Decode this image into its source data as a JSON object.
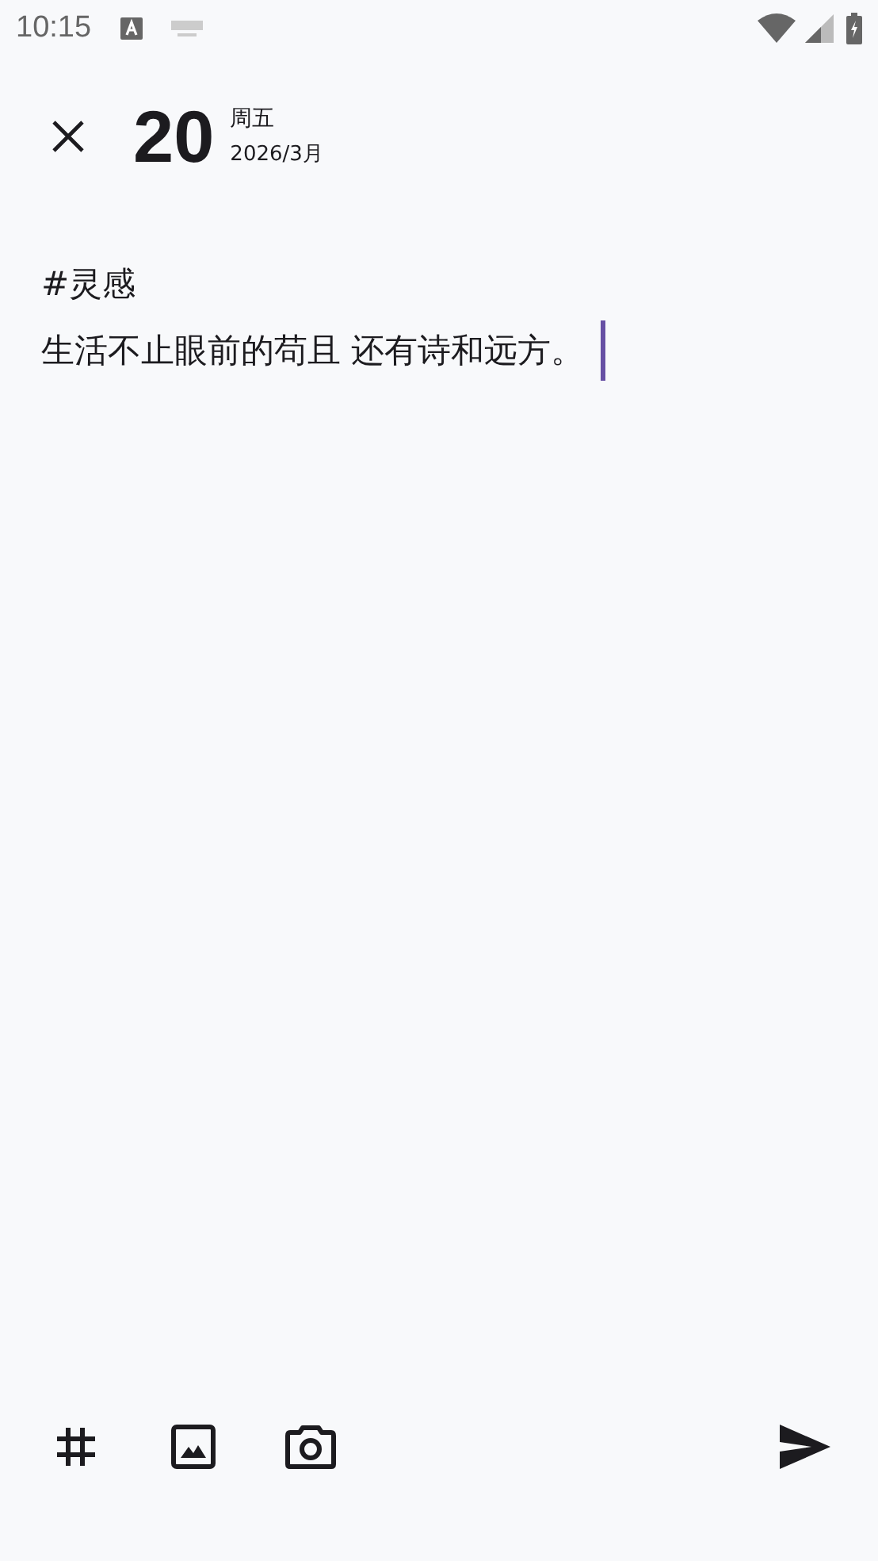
{
  "status_bar": {
    "time": "10:15"
  },
  "header": {
    "day": "20",
    "weekday": "周五",
    "year_month": "2026/3月"
  },
  "note": {
    "tag": "#灵感",
    "body": "生活不止眼前的苟且 还有诗和远方。"
  }
}
